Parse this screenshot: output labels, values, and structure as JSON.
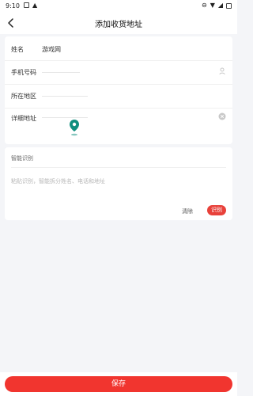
{
  "status_bar": {
    "time": "9:10"
  },
  "nav": {
    "title": "添加收货地址"
  },
  "form": {
    "name_label": "姓名",
    "name_value": "游戏网",
    "phone_label": "手机号码",
    "region_label": "所在地区",
    "detail_label": "详细地址"
  },
  "smart_recognition": {
    "title": "智能识别",
    "placeholder": "粘贴识别，智能拆分姓名、电话和地址",
    "clear_label": "清除",
    "identify_label": "识别"
  },
  "actions": {
    "save_label": "保存"
  },
  "colors": {
    "accent": "#f1352f",
    "pin": "#0f8f7f",
    "background": "#f4f5f8"
  }
}
